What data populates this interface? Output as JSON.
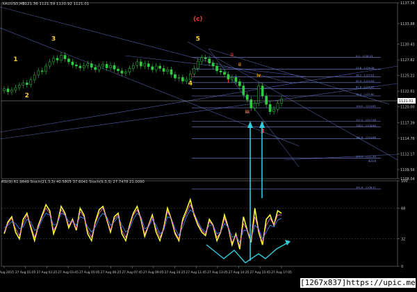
{
  "header": {
    "symbol_line": "XAUUSD,M5",
    "ohlc_line": "1121.36 1121.59 1120.92 1121.01"
  },
  "watermark": "[1267x837]https://upic.me/",
  "chart_data": [
    {
      "type": "line",
      "title": "",
      "subtype": "candlestick-price",
      "yticks": [
        "1137.34",
        "1133.88",
        "1130.43",
        "1127.82",
        "1125.21",
        "1122.61",
        "1120.00",
        "1117.39",
        "1114.78",
        "1112.17",
        "1109.56",
        "1108.04"
      ],
      "current_price_label": "1121.01",
      "ylim": [
        1108.04,
        1137.34
      ],
      "x_times": [
        "26 Aug 2015",
        "27 Aug 01:05",
        "27 Aug 02:25",
        "27 Aug 03:45",
        "27 Aug 05:05",
        "27 Aug 06:25",
        "27 Aug 07:45",
        "27 Aug 09:05",
        "27 Aug 10:25",
        "27 Aug 11:45",
        "27 Aug 13:05",
        "27 Aug 14:25",
        "27 Aug 15:45",
        "27 Aug 17:05"
      ],
      "close_series": [
        1123.0,
        1122.5,
        1122.8,
        1123.2,
        1123.6,
        1124.0,
        1123.7,
        1124.5,
        1125.3,
        1126.0,
        1125.9,
        1126.8,
        1127.5,
        1128.1,
        1127.8,
        1128.6,
        1128.0,
        1127.5,
        1127.0,
        1126.8,
        1126.5,
        1126.9,
        1127.2,
        1126.6,
        1126.2,
        1126.8,
        1127.1,
        1126.5,
        1126.9,
        1126.3,
        1126.0,
        1125.6,
        1125.8,
        1126.4,
        1126.9,
        1127.5,
        1126.8,
        1127.2,
        1126.7,
        1126.2,
        1126.8,
        1126.4,
        1125.9,
        1126.2,
        1125.4,
        1124.8,
        1124.9,
        1124.3,
        1124.6,
        1125.5,
        1126.4,
        1127.6,
        1128.2,
        1128.0,
        1127.3,
        1126.8,
        1126.0,
        1125.8,
        1125.4,
        1124.6,
        1124.9,
        1124.2,
        1123.5,
        1122.0,
        1121.2,
        1119.8,
        1120.6,
        1123.5,
        1121.8,
        1120.4,
        1119.2,
        1119.6,
        1120.6,
        1121.3
      ],
      "elliott_labels": [
        {
          "text": "1",
          "color": "#ffcc33",
          "time_index": 3,
          "price": 1127.6
        },
        {
          "text": "2",
          "color": "#ffcc33",
          "time_index": 6,
          "price": 1121.6
        },
        {
          "text": "3",
          "color": "#ffcc33",
          "time_index": 13,
          "price": 1131.0
        },
        {
          "text": "4",
          "color": "#ffcc33",
          "time_index": 49,
          "price": 1123.6
        },
        {
          "text": "5",
          "color": "#ffcc33",
          "time_index": 51,
          "price": 1131.0
        },
        {
          "text": "(c)",
          "color": "#ff3333",
          "time_index": 51,
          "price": 1134.3
        },
        {
          "text": "3",
          "color": "#ff3333",
          "time_index": 68,
          "price": 1115.6
        },
        {
          "text": "iii",
          "color": "#ff9900",
          "time_index": 64,
          "price": 1118.9
        },
        {
          "text": "iv",
          "color": "#ff9900",
          "time_index": 67,
          "price": 1125.0
        },
        {
          "text": "v",
          "color": "#ff9900",
          "time_index": 68,
          "price": 1117.1
        },
        {
          "text": "ii",
          "color": "#ff9900",
          "time_index": 62,
          "price": 1126.8
        },
        {
          "text": "i",
          "color": "#ff3333",
          "time_index": 59,
          "price": 1124.0
        },
        {
          "text": "ii",
          "color": "#ff3333",
          "time_index": 60,
          "price": 1128.4
        }
      ],
      "fib_levels": [
        "0.0 - 1128.23",
        "23.6 - 1126.26",
        "38.2 - 1125.03",
        "50.0 - 1124.04",
        "61.8 - 1123.05",
        "76.4 - 1121.82",
        "100.0 - 1119.85",
        "127.2 - 1117.58",
        "138.2 - 1116.66",
        "161.8 - 1114.68",
        "200.0 - 1111.48",
        "261.8 - 1106.31",
        "423.6"
      ],
      "indicator_label": "-"
    },
    {
      "type": "line",
      "title": "RSI(9) 61.9649  Stoch(21,3,3) 40.5805 37.6041  Stoch(9,3,3) 27.7478 21.0090",
      "ylim": [
        0,
        100
      ],
      "yticks": [
        "100",
        "68",
        "32",
        "0"
      ],
      "series": [
        {
          "name": "RSI(9)",
          "color": "#ffff33",
          "values": [
            38,
            52,
            58,
            40,
            32,
            55,
            62,
            45,
            30,
            48,
            60,
            72,
            65,
            38,
            50,
            70,
            62,
            45,
            55,
            42,
            68,
            60,
            38,
            30,
            52,
            66,
            70,
            55,
            40,
            58,
            62,
            38,
            30,
            48,
            62,
            70,
            55,
            35,
            48,
            60,
            40,
            30,
            45,
            68,
            55,
            38,
            30,
            55,
            66,
            78,
            60,
            48,
            40,
            36,
            55,
            48,
            30,
            40,
            60,
            45,
            25,
            38,
            20,
            58,
            42,
            28,
            68,
            40,
            25,
            55,
            60,
            48,
            65,
            62
          ]
        },
        {
          "name": "Stoch(21,3,3)",
          "color": "#3399ff",
          "values": [
            45,
            48,
            52,
            50,
            44,
            46,
            55,
            52,
            42,
            44,
            55,
            62,
            60,
            48,
            50,
            62,
            60,
            52,
            52,
            48,
            58,
            56,
            46,
            40,
            46,
            56,
            62,
            58,
            48,
            52,
            58,
            48,
            40,
            44,
            55,
            62,
            58,
            44,
            46,
            55,
            48,
            38,
            42,
            58,
            56,
            44,
            36,
            46,
            58,
            66,
            62,
            52,
            44,
            40,
            48,
            48,
            38,
            40,
            50,
            46,
            34,
            36,
            28,
            42,
            42,
            32,
            48,
            44,
            32,
            40,
            48,
            46,
            54,
            56
          ]
        },
        {
          "name": "Stoch(9,3,3)",
          "color": "#ff66cc",
          "values": [
            40,
            50,
            56,
            44,
            36,
            50,
            60,
            48,
            34,
            46,
            58,
            68,
            62,
            42,
            50,
            66,
            60,
            48,
            54,
            44,
            64,
            58,
            42,
            34,
            50,
            62,
            68,
            56,
            42,
            55,
            60,
            42,
            34,
            46,
            60,
            66,
            56,
            38,
            48,
            58,
            44,
            34,
            44,
            64,
            56,
            40,
            32,
            52,
            62,
            72,
            62,
            50,
            42,
            38,
            52,
            48,
            34,
            40,
            56,
            44,
            28,
            36,
            24,
            50,
            42,
            30,
            58,
            42,
            28,
            48,
            56,
            48,
            60,
            60
          ]
        }
      ]
    }
  ]
}
